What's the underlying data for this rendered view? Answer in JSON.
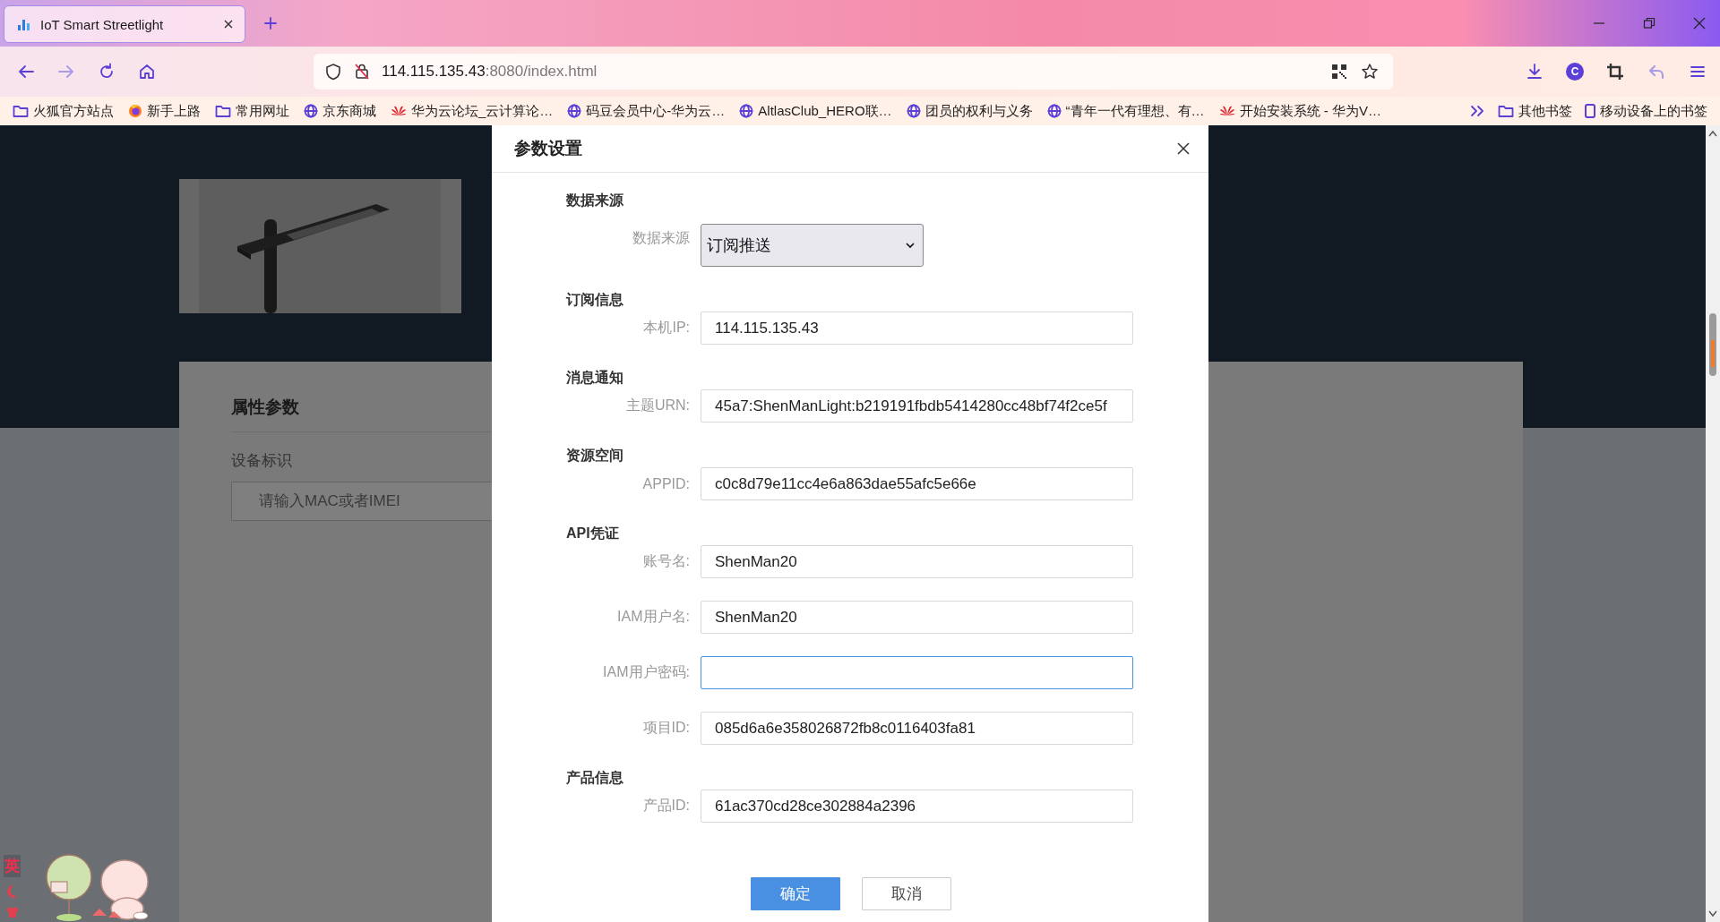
{
  "browser": {
    "tab": {
      "title": "IoT Smart Streetlight",
      "selected": true
    },
    "url": {
      "host": "114.115.135.43",
      "path": ":8080/index.html"
    },
    "extension_letter": "C",
    "bookmarks": [
      {
        "kind": "folder",
        "label": "火狐官方站点"
      },
      {
        "kind": "firefox",
        "label": "新手上路"
      },
      {
        "kind": "folder",
        "label": "常用网址"
      },
      {
        "kind": "globe",
        "label": "京东商城"
      },
      {
        "kind": "huawei",
        "label": "华为云论坛_云计算论…"
      },
      {
        "kind": "globe",
        "label": "码豆会员中心-华为云…"
      },
      {
        "kind": "globe",
        "label": "AltlasClub_HERO联…"
      },
      {
        "kind": "globe",
        "label": "团员的权利与义务"
      },
      {
        "kind": "globe",
        "label": "“青年一代有理想、有…"
      },
      {
        "kind": "huawei",
        "label": "开始安装系统 - 华为V…"
      }
    ],
    "other_bookmarks": [
      {
        "kind": "folder",
        "label": "其他书签"
      },
      {
        "kind": "device",
        "label": "移动设备上的书签"
      }
    ]
  },
  "page": {
    "panel_title": "属性参数",
    "field_label": "设备标识",
    "field_placeholder": "请输入MAC或者IMEI"
  },
  "dialog": {
    "title": "参数设置",
    "sections": [
      {
        "title": "数据来源",
        "fields": [
          {
            "kind": "select",
            "label": "数据来源",
            "value": "订阅推送",
            "focused": false
          }
        ]
      },
      {
        "title": "订阅信息",
        "fields": [
          {
            "kind": "input",
            "label": "本机IP:",
            "value": "114.115.135.43",
            "focused": false
          }
        ]
      },
      {
        "title": "消息通知",
        "fields": [
          {
            "kind": "input",
            "label": "主题URN:",
            "value": "45a7:ShenManLight:b219191fbdb5414280cc48bf74f2ce5f",
            "focused": false
          }
        ]
      },
      {
        "title": "资源空间",
        "fields": [
          {
            "kind": "input",
            "label": "APPID:",
            "value": "c0c8d79e11cc4e6a863dae55afc5e66e",
            "focused": false
          }
        ]
      },
      {
        "title": "API凭证",
        "fields": [
          {
            "kind": "input",
            "label": "账号名:",
            "value": "ShenMan20",
            "focused": false
          },
          {
            "kind": "input",
            "label": "IAM用户名:",
            "value": "ShenMan20",
            "focused": false
          },
          {
            "kind": "input",
            "label": "IAM用户密码:",
            "focused": true
          },
          {
            "kind": "input",
            "label": "项目ID:",
            "value": "085d6a6e358026872fb8c0116403fa81",
            "focused": false
          }
        ]
      },
      {
        "title": "产品信息",
        "fields": [
          {
            "kind": "input",
            "label": "产品ID:",
            "value": "61ac370cd28ce302884a2396",
            "focused": false
          }
        ]
      }
    ],
    "buttons": [
      {
        "kind": "primary",
        "label": "确定"
      },
      {
        "kind": "secondary",
        "label": "取消"
      }
    ]
  },
  "ime_indicator": "英"
}
